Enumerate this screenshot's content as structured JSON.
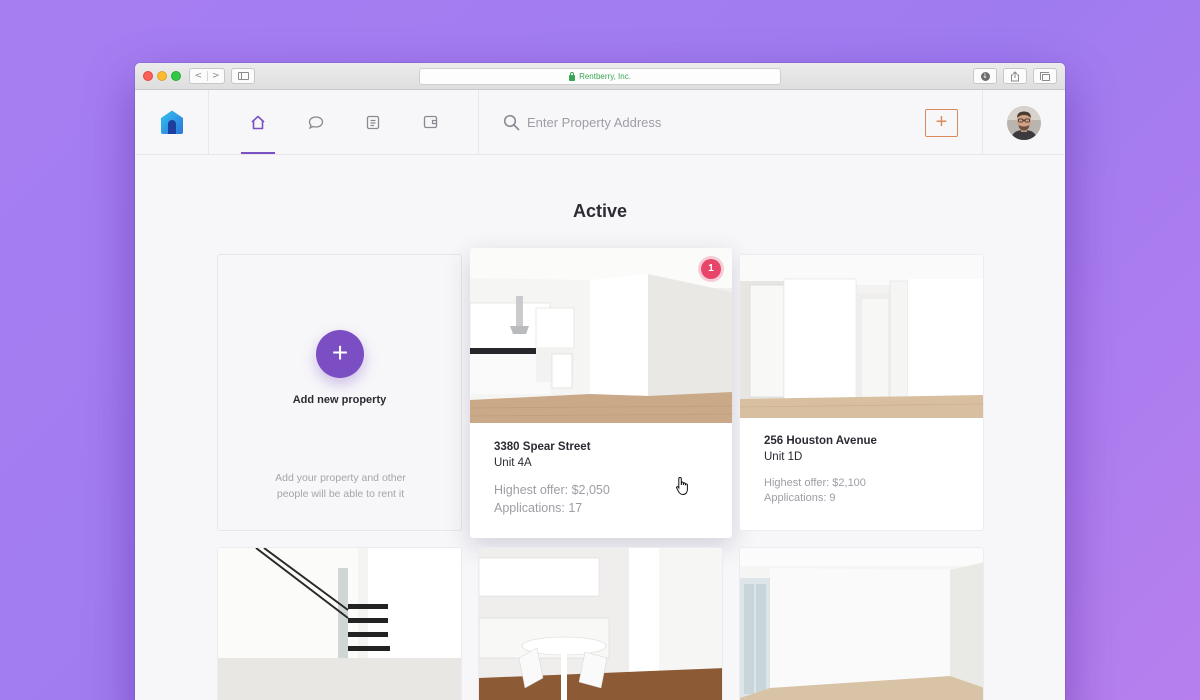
{
  "browser": {
    "url": "Rentberry, Inc.",
    "nav_back": "<",
    "nav_forward": ">"
  },
  "header": {
    "logo_icon": "house-logo-icon",
    "tabs": [
      {
        "name": "home-icon",
        "active": true
      },
      {
        "name": "chat-icon",
        "active": false
      },
      {
        "name": "document-icon",
        "active": false
      },
      {
        "name": "wallet-icon",
        "active": false
      }
    ],
    "search_placeholder": "Enter Property Address",
    "add_label": "+",
    "accent_color": "#7b51c2",
    "add_color": "#d98a5c"
  },
  "main": {
    "title": "Active",
    "add_card": {
      "button": "+",
      "label": "Add new property",
      "hint": "Add your property and other people will be able to rent it"
    },
    "properties": [
      {
        "address": "3380 Spear Street",
        "unit": "Unit 4A",
        "offer": "Highest offer: $2,050",
        "applications": "Applications: 17",
        "badge": "1"
      },
      {
        "address": "256 Houston Avenue",
        "unit": "Unit 1D",
        "offer": "Highest offer: $2,100",
        "applications": "Applications: 9"
      }
    ]
  }
}
